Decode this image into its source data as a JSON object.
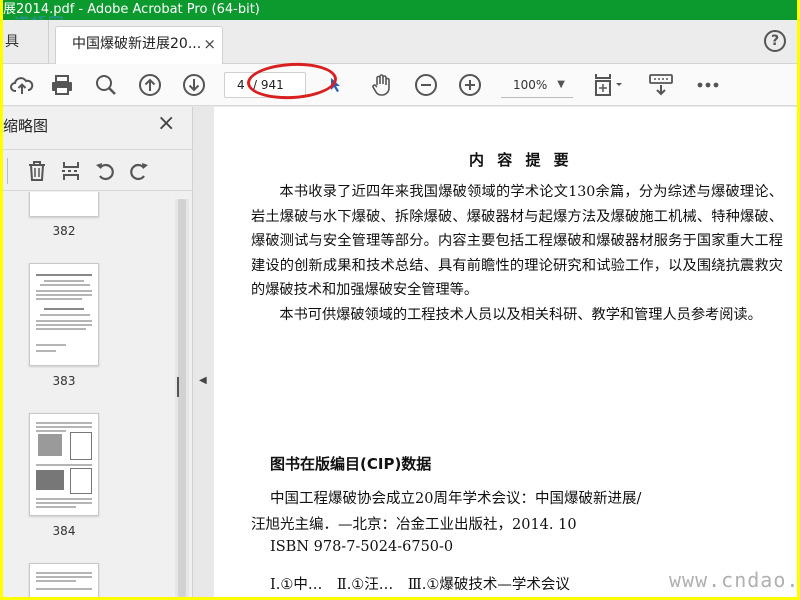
{
  "window": {
    "title": "展2014.pdf - Adobe Acrobat Pro (64-bit)",
    "watermark_top": "道桥网",
    "watermark_bottom": "www.cndao.com"
  },
  "tabs": {
    "tools_label": "具",
    "doc_tab_label": "中国爆破新进展20...",
    "close_symbol": "×",
    "help_symbol": "?"
  },
  "toolbar": {
    "current_page": "4",
    "total_pages": "/ 941",
    "zoom": "100%",
    "highlight_color": "#d92020"
  },
  "sidebar": {
    "title": "缩略图",
    "close_symbol": "×",
    "thumbnails": [
      {
        "label": "382"
      },
      {
        "label": "383"
      },
      {
        "label": "384"
      }
    ]
  },
  "document": {
    "heading": "内 容 提 要",
    "paragraph1": "本书收录了近四年来我国爆破领域的学术论文130余篇，分为综述与爆破理论、岩土爆破与水下爆破、拆除爆破、爆破器材与起爆方法及爆破施工机械、特种爆破、爆破测试与安全管理等部分。内容主要包括工程爆破和爆破器材服务于国家重大工程建设的创新成果和技术总结、具有前瞻性的理论研究和试验工作，以及围绕抗震救灾的爆破技术和加强爆破安全管理等。",
    "paragraph2": "本书可供爆破领域的工程技术人员以及相关科研、教学和管理人员参考阅读。",
    "cip_heading": "图书在版编目(CIP)数据",
    "cip_line1": "中国工程爆破协会成立20周年学术会议：中国爆破新进展/",
    "cip_line2": "汪旭光主编．—北京：冶金工业出版社，2014. 10",
    "cip_line3": "ISBN 978-7-5024-6750-0",
    "cip_line4": "Ⅰ.①中…　Ⅱ.①汪…　Ⅲ.①爆破技术—学术会议"
  }
}
